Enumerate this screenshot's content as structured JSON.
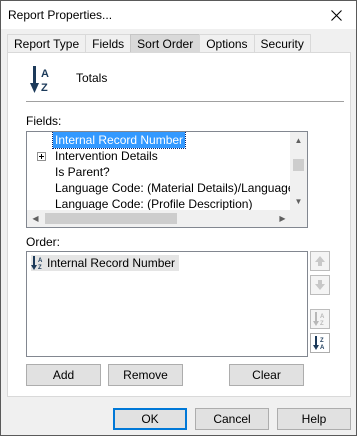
{
  "window": {
    "title": "Report Properties..."
  },
  "tabs": [
    {
      "label": "Report Type",
      "active": false
    },
    {
      "label": "Fields",
      "active": false
    },
    {
      "label": "Sort Order",
      "active": true
    },
    {
      "label": "Options",
      "active": false
    },
    {
      "label": "Security",
      "active": false
    }
  ],
  "sort_header": {
    "label": "Totals",
    "icon": "sort-ascending-az-icon"
  },
  "fields": {
    "label": "Fields:",
    "items": [
      {
        "text": "Internal Record Number",
        "selected": true,
        "expandable": false
      },
      {
        "text": "Intervention Details",
        "selected": false,
        "expandable": true
      },
      {
        "text": "Is Parent?",
        "selected": false,
        "expandable": false
      },
      {
        "text": "Language Code: (Material Details)/Language Code",
        "selected": false,
        "expandable": false
      },
      {
        "text": "Language Code: (Profile Description)",
        "selected": false,
        "expandable": false
      }
    ]
  },
  "order": {
    "label": "Order:",
    "items": [
      {
        "text": "Internal Record Number",
        "icon": "sort-ascending-az-icon"
      }
    ]
  },
  "side_buttons": [
    {
      "name": "move-up-button",
      "icon": "arrow-up-icon",
      "enabled": false
    },
    {
      "name": "move-down-button",
      "icon": "arrow-down-icon",
      "enabled": false
    },
    {
      "name": "sort-ascending-button",
      "icon": "sort-ascending-az-icon",
      "enabled": false
    },
    {
      "name": "sort-descending-button",
      "icon": "sort-descending-za-icon",
      "enabled": true
    }
  ],
  "buttons": {
    "add": "Add",
    "remove": "Remove",
    "clear": "Clear"
  },
  "footer": {
    "ok": "OK",
    "cancel": "Cancel",
    "help": "Help"
  },
  "colors": {
    "selection": "#3399ff",
    "accent": "#0078d7",
    "icon_dark": "#1c3a5a"
  }
}
